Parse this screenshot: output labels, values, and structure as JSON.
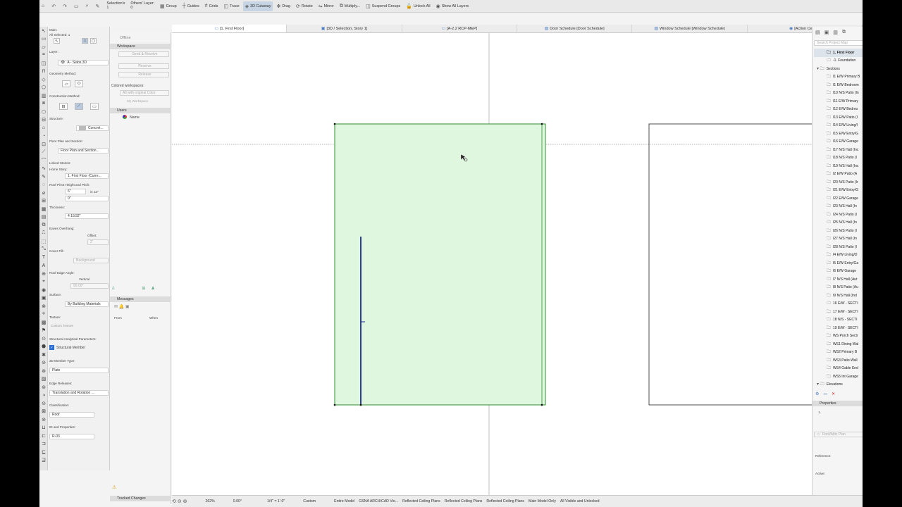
{
  "toolbar": {
    "selection_label": "Selection's",
    "selection_count": "1",
    "others_label": "Others' Layer:",
    "others_count": "0",
    "items": [
      {
        "glyph": "⌂",
        "label": ""
      },
      {
        "glyph": "↶",
        "label": ""
      },
      {
        "glyph": "↷",
        "label": ""
      },
      {
        "glyph": "▭",
        "label": ""
      },
      {
        "glyph": "⌕",
        "label": ""
      },
      {
        "glyph": "✎",
        "label": ""
      },
      {
        "glyph": "▦",
        "label": "Group"
      },
      {
        "glyph": "┼",
        "label": "Guides"
      },
      {
        "glyph": "#",
        "label": "Grids"
      },
      {
        "glyph": "◫",
        "label": "Trace"
      },
      {
        "glyph": "◈",
        "label": "3D Cutaway"
      },
      {
        "glyph": "✥",
        "label": "Drag"
      },
      {
        "glyph": "⟳",
        "label": "Rotate"
      },
      {
        "glyph": "⇋",
        "label": "Mirror"
      },
      {
        "glyph": "⧉",
        "label": "Multiply..."
      },
      {
        "glyph": "◫",
        "label": "Suspend Groups"
      },
      {
        "glyph": "🔓",
        "label": "Unlock All"
      },
      {
        "glyph": "◉",
        "label": "Show All Layers"
      }
    ]
  },
  "tabs": [
    {
      "icon": "▭",
      "label": "[1. First Floor]"
    },
    {
      "icon": "▣",
      "label": "[3D / Selection, Story 1]"
    },
    {
      "icon": "▭",
      "label": "[A-2.2 RCP-MEP]"
    },
    {
      "icon": "▤",
      "label": "Door Schedule [Door Schedule]"
    },
    {
      "icon": "▤",
      "label": "Window Schedule [Window Schedule]"
    },
    {
      "icon": "◉",
      "label": "[Action Center]"
    }
  ],
  "info": {
    "main_label": "Main:",
    "all_selected": "All Selected: 1",
    "layer_label": "Layer:",
    "layer_value": "A - Slabs.3D",
    "geometry_label": "Geometry Method:",
    "construction_label": "Construction Method:",
    "structure_label": "Structure:",
    "structure_value": "Concret...",
    "floorplan_label": "Floor Plan and Section:",
    "floorplan_value": "Floor Plan and Section...",
    "linked_label": "Linked Stories:",
    "home_story_label": "Home Story:",
    "home_story_value": "1. First Floor (Curre...",
    "pivot_label": "Roof Pivot Height and Pitch:",
    "pitch_value": "6\"",
    "pitch_unit": "in 12\"",
    "height_value": "0\"",
    "thickness_label": "Thickness:",
    "thickness_value": "4 15/32\"",
    "eaves_label": "Eaves Overhang:",
    "offset_label": "Offset:",
    "offset_value": "2'",
    "cover_label": "Cover Fill:",
    "cover_value": "Background",
    "edge_angle_label": "Roof Edge Angle:",
    "edge_angle_value": "Vertical",
    "edge_angle_deg": "90.00°",
    "surface_label": "Surface:",
    "surface_value": "By Building Materials",
    "texture_label": "Texture:",
    "texture_value": "Custom Texture",
    "struct_params_label": "Structural Analytical Parameters:",
    "struct_member": "Structural Member",
    "member_type_label": "2D Member Type:",
    "member_type_value": "Plate",
    "edge_rel_label": "Edge Releases:",
    "edge_rel_value": "Translation and Rotation ...",
    "class_label": "Classification:",
    "class_value": "Roof",
    "id_label": "ID and Properties:",
    "id_value": "R-03"
  },
  "team": {
    "offline": "Offline",
    "workspace": "Workspace",
    "send_receive": "Send & Receive",
    "reserve": "Reserve",
    "release": "Release",
    "colored_ws": "Colored workspaces:",
    "all_color": "All with original Color",
    "my_ws": "My Workspace",
    "users": "Users",
    "name_col": "Name",
    "messages": "Messages",
    "from_col": "From",
    "when_col": "When",
    "tracked": "Tracked Changes"
  },
  "navigator": {
    "search_placeholder": "Search Project Map",
    "items": [
      {
        "label": "1. First Floor",
        "indent": 1,
        "bold": true
      },
      {
        "label": "-1. Foundation",
        "indent": 1
      },
      {
        "label": "Sections",
        "indent": 0,
        "open": true
      },
      {
        "label": "I1 E/W Primary B",
        "indent": 2
      },
      {
        "label": "I1 E/W Bedroom",
        "indent": 2
      },
      {
        "label": "I10 N/S Patio (In",
        "indent": 2
      },
      {
        "label": "I11 E/W Primary",
        "indent": 2
      },
      {
        "label": "I12 E/W Bedroo",
        "indent": 2
      },
      {
        "label": "I13 E/W Patio (I",
        "indent": 2
      },
      {
        "label": "I14 E/W Living/I",
        "indent": 2
      },
      {
        "label": "I15 E/W Entry/G",
        "indent": 2
      },
      {
        "label": "I16 E/W Garage",
        "indent": 2
      },
      {
        "label": "I17 N/S Hall (Inc",
        "indent": 2
      },
      {
        "label": "I18 N/S Patio (I",
        "indent": 2
      },
      {
        "label": "I19 N/S Hall (Inc",
        "indent": 2
      },
      {
        "label": "I2 E/W Patio (A",
        "indent": 2
      },
      {
        "label": "I20 N/S Patio (Ir",
        "indent": 2
      },
      {
        "label": "I21 E/W Entry/G",
        "indent": 2
      },
      {
        "label": "I22 E/W Garage",
        "indent": 2
      },
      {
        "label": "I23 N/S Hall (In",
        "indent": 2
      },
      {
        "label": "I24 N/S Patio (I",
        "indent": 2
      },
      {
        "label": "I25 N/S Hall (In",
        "indent": 2
      },
      {
        "label": "I26 N/S Patio (I",
        "indent": 2
      },
      {
        "label": "I27 N/S Hall (In",
        "indent": 2
      },
      {
        "label": "I28 N/S Patio (I",
        "indent": 2
      },
      {
        "label": "I4 E/W Living/D",
        "indent": 2
      },
      {
        "label": "I5 E/W Entry/Ga",
        "indent": 2
      },
      {
        "label": "I6 E/W Garage",
        "indent": 2
      },
      {
        "label": "I7 N/S Hall (Aut",
        "indent": 2
      },
      {
        "label": "I8 N/S Patio (Au",
        "indent": 2
      },
      {
        "label": "I9 N/S Hall (Ind",
        "indent": 2
      },
      {
        "label": "16 E/W - SECTI",
        "indent": 2
      },
      {
        "label": "17 E/W - SECTI",
        "indent": 2
      },
      {
        "label": "18 N/S - SECTI",
        "indent": 2
      },
      {
        "label": "19 E/W - SECTI",
        "indent": 2
      },
      {
        "label": "WS Porch Secti",
        "indent": 2
      },
      {
        "label": "WS1 Dining Wal",
        "indent": 2
      },
      {
        "label": "WS2 Primary B",
        "indent": 2
      },
      {
        "label": "WS3 Patio Wall",
        "indent": 2
      },
      {
        "label": "WS4 Gable End",
        "indent": 2
      },
      {
        "label": "WS5 Int Garage",
        "indent": 2
      },
      {
        "label": "Elevations",
        "indent": 0
      }
    ],
    "properties_label": "Properties",
    "prop_value": "1.",
    "view_name": "Roof/Attic Plan",
    "reference_label": "Reference:",
    "active_label": "Active:"
  },
  "status": {
    "zoom": "262%",
    "angle": "0.00°",
    "scale": "1/4\" = 1'-0\"",
    "custom": "Custom",
    "model": "Entire Model",
    "pen_set": "GSNA ARCHICAD Vie...",
    "rcp1": "Reflected Ceiling Plans",
    "rcp2": "Reflected Ceiling Plans",
    "rcp3": "Reflected Ceiling Plans",
    "main_model": "Main Model Only",
    "visible": "All Visible and Unlocked"
  },
  "colors": {
    "slab_fill": "#dff7df",
    "slab_stroke": "#2e8b2e",
    "edge_blue": "#1a2a8c"
  }
}
